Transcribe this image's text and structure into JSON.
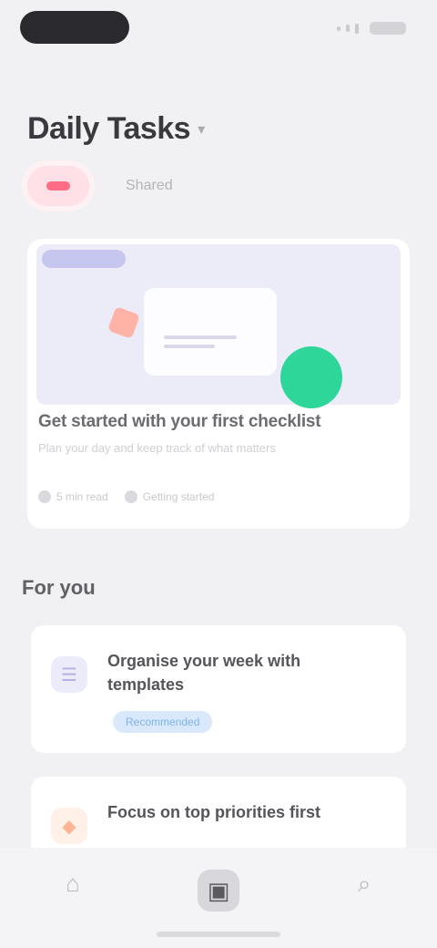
{
  "app": {
    "title": "Daily Tasks",
    "title_chevron_icon": "chevron-down-icon"
  },
  "chips": [
    {
      "label": "",
      "active": true,
      "accent": "#ff6c86"
    },
    {
      "label": "Shared",
      "active": false
    }
  ],
  "feature": {
    "badge": "",
    "title": "Get started with your first checklist",
    "subtitle": "Plan your day and keep track of what matters",
    "meta": [
      {
        "icon": "clock-icon",
        "label": "5 min read"
      },
      {
        "icon": "user-icon",
        "label": "Getting started"
      }
    ],
    "colors": {
      "hero_bg": "#ecebf8",
      "green": "#2ed69a",
      "red": "#ffb3a6"
    }
  },
  "section": {
    "title": "For you"
  },
  "tasks": [
    {
      "icon": "note-icon",
      "glyph": "☰",
      "title": "Organise your week with templates",
      "tag": "Recommended",
      "icon_bg": "#ecebfa",
      "icon_color": "#b3b1e6"
    },
    {
      "icon": "flame-icon",
      "glyph": "◆",
      "title": "Focus on top priorities first",
      "tag": "",
      "icon_bg": "#fff0e8",
      "icon_color": "#ffb493"
    }
  ],
  "tabs": [
    {
      "icon": "home-icon",
      "glyph": "⌂",
      "active": false
    },
    {
      "icon": "inbox-icon",
      "glyph": "▣",
      "active": true
    },
    {
      "icon": "search-icon",
      "glyph": "⌕",
      "active": false
    }
  ]
}
